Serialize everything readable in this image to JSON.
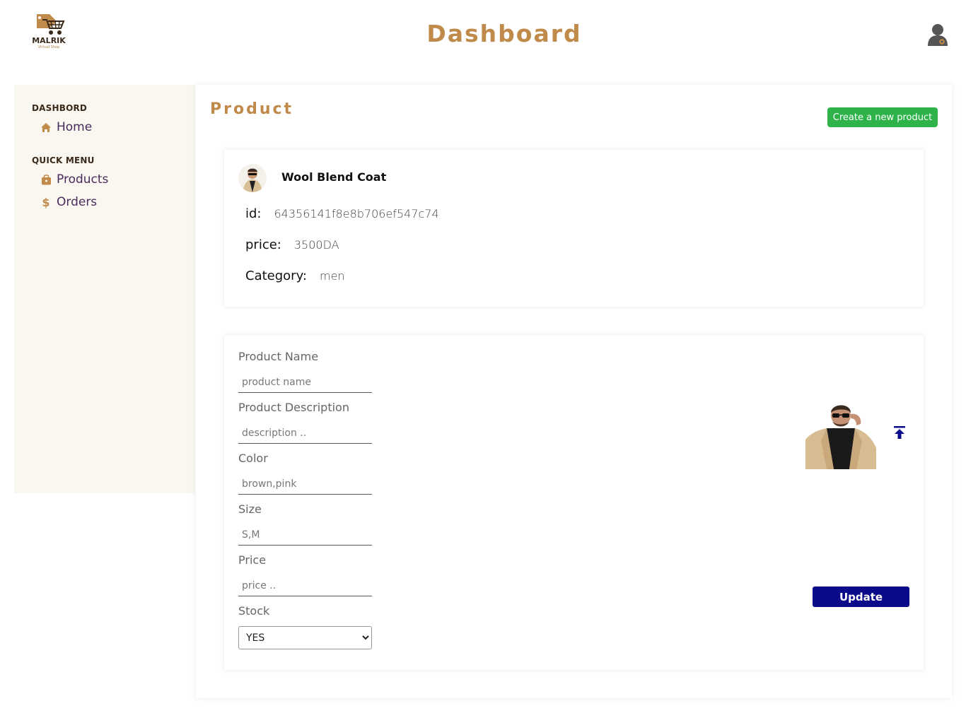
{
  "header": {
    "logo_name": "MALRIK",
    "logo_subtitle": "Virtual Shop",
    "title": "Dashboard",
    "user_icon": "user-icon"
  },
  "sidebar": {
    "sections": [
      {
        "title": "DASHBORD",
        "items": [
          {
            "label": "Home",
            "icon": "home-icon"
          }
        ]
      },
      {
        "title": "QUICK MENU",
        "items": [
          {
            "label": "Products",
            "icon": "shopping-bag-icon"
          },
          {
            "label": "Orders",
            "icon": "dollar-icon"
          }
        ]
      }
    ]
  },
  "main": {
    "title": "Product",
    "create_button": "Create a new product",
    "product": {
      "name": "Wool Blend Coat",
      "id_label": "id:",
      "id_value": "64356141f8e8b706ef547c74",
      "price_label": "price:",
      "price_value": "3500DA",
      "category_label": "Category:",
      "category_value": "men"
    },
    "form": {
      "name_label": "Product Name",
      "name_placeholder": "product name",
      "description_label": "Product Description",
      "description_placeholder": "description ..",
      "color_label": "Color",
      "color_placeholder": "brown,pink",
      "size_label": "Size",
      "size_placeholder": "S,M",
      "price_label": "Price",
      "price_placeholder": "price ..",
      "stock_label": "Stock",
      "stock_value": "YES",
      "update_button": "Update"
    }
  },
  "colors": {
    "accent": "#c08a4a",
    "nav_text": "#4a2a5a",
    "create_button": "#2db34a",
    "update_button": "#0a0a8a",
    "sidebar_bg": "#faf7f1"
  }
}
